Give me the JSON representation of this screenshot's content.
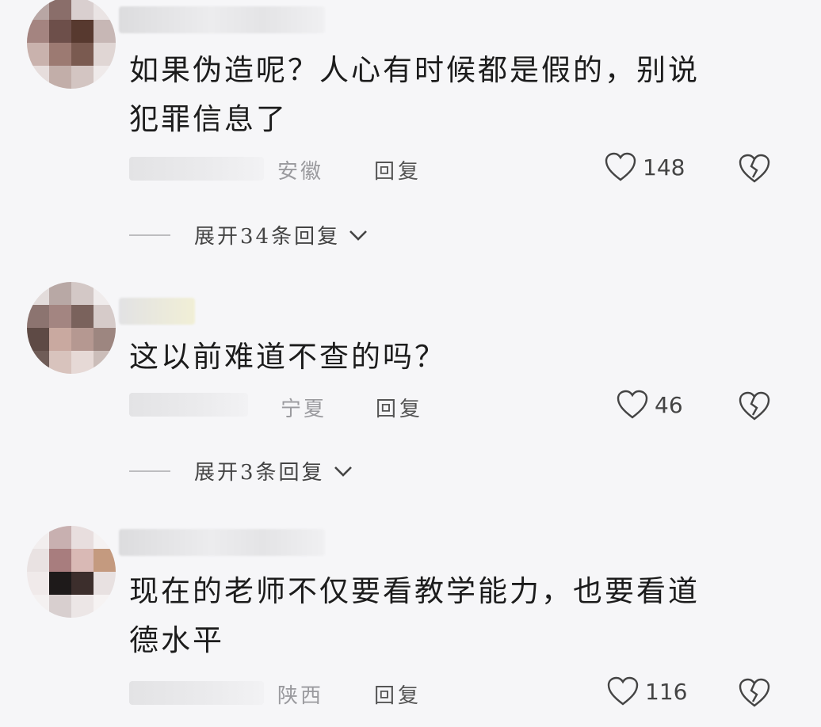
{
  "comments": [
    {
      "text_line1": "如果伪造呢？人心有时候都是假的，别说",
      "text_line2": "犯罪信息了",
      "location": "安徽",
      "reply_label": "回复",
      "likes": "148",
      "expand_label": "展开34条回复"
    },
    {
      "text_line1": "这以前难道不查的吗？",
      "text_line2": "",
      "location": "宁夏",
      "reply_label": "回复",
      "likes": "46",
      "expand_label": "展开3条回复"
    },
    {
      "text_line1": "现在的老师不仅要看教学能力，也要看道",
      "text_line2": "德水平",
      "location": "陕西",
      "reply_label": "回复",
      "likes": "116",
      "expand_label": ""
    }
  ],
  "icons": {
    "like": "heart-outline-icon",
    "dislike": "broken-heart-icon",
    "expand": "chevron-down-icon"
  }
}
